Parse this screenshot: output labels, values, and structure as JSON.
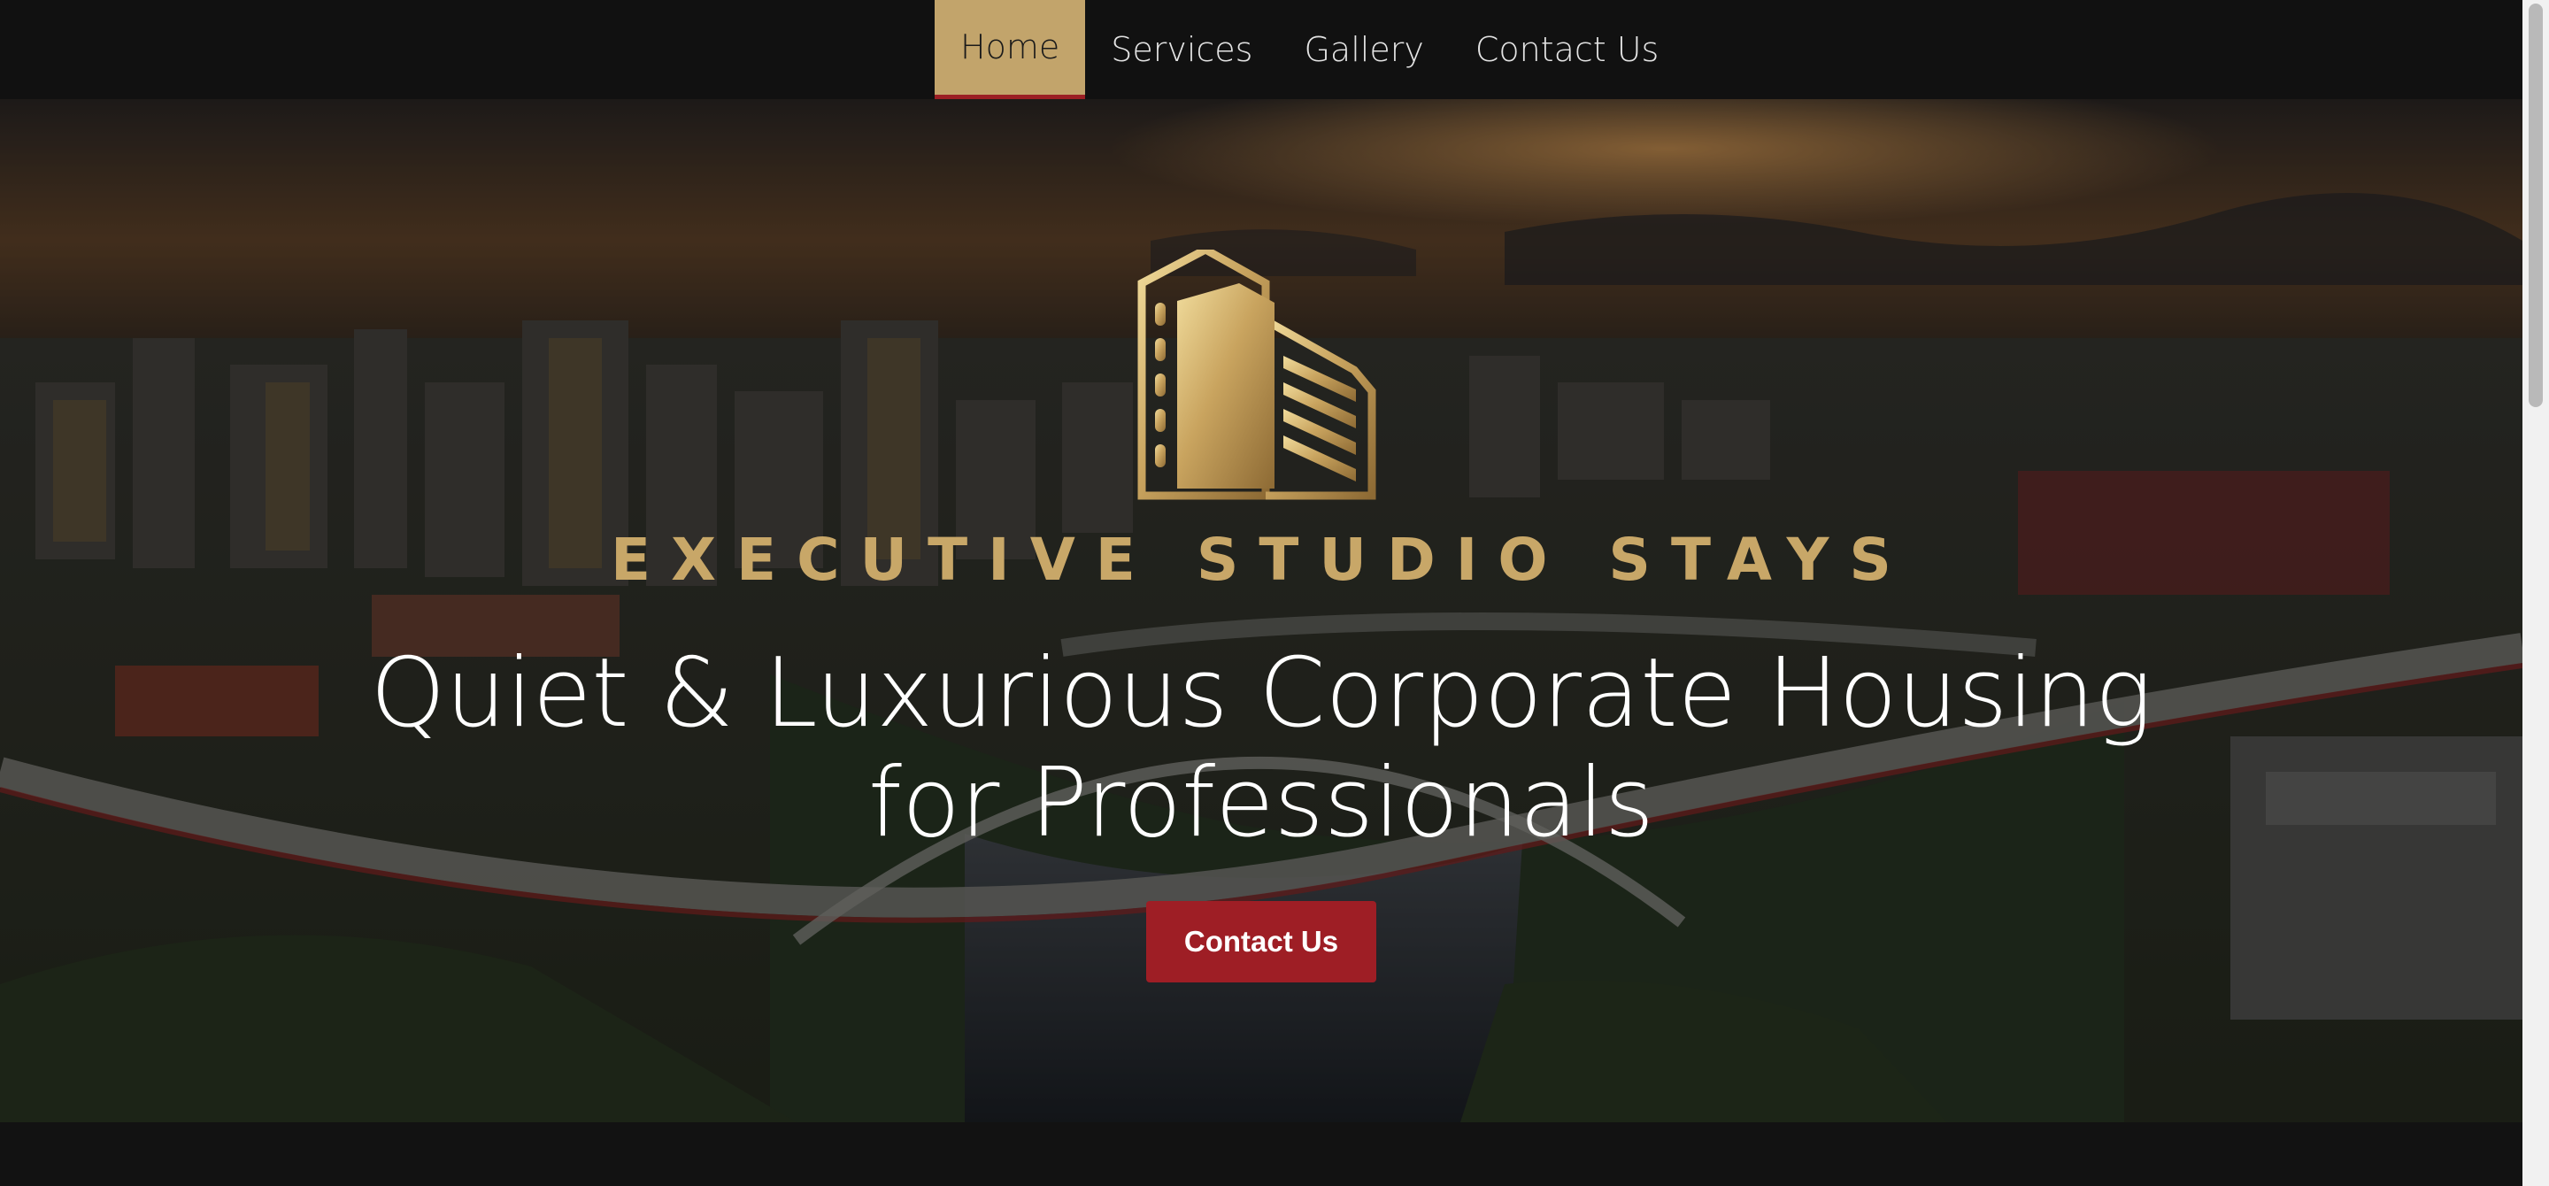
{
  "nav": {
    "items": [
      {
        "label": "Home",
        "active": true
      },
      {
        "label": "Services",
        "active": false
      },
      {
        "label": "Gallery",
        "active": false
      },
      {
        "label": "Contact Us",
        "active": false
      }
    ]
  },
  "hero": {
    "brand_name": "EXECUTIVE STUDIO STAYS",
    "headline_line1": "Quiet & Luxurious Corporate Housing",
    "headline_line2": "for Professionals",
    "cta_label": "Contact Us",
    "background": "aerial city skyline at sunset with river and bridge"
  },
  "colors": {
    "nav_bg": "#111111",
    "active_tab_bg": "#c2a46b",
    "active_tab_underline": "#9b1f24",
    "brand_gold": "#c8a768",
    "cta_bg": "#9e1e25",
    "page_bg": "#121212"
  },
  "icons": {
    "logo": "building-logo-icon"
  }
}
